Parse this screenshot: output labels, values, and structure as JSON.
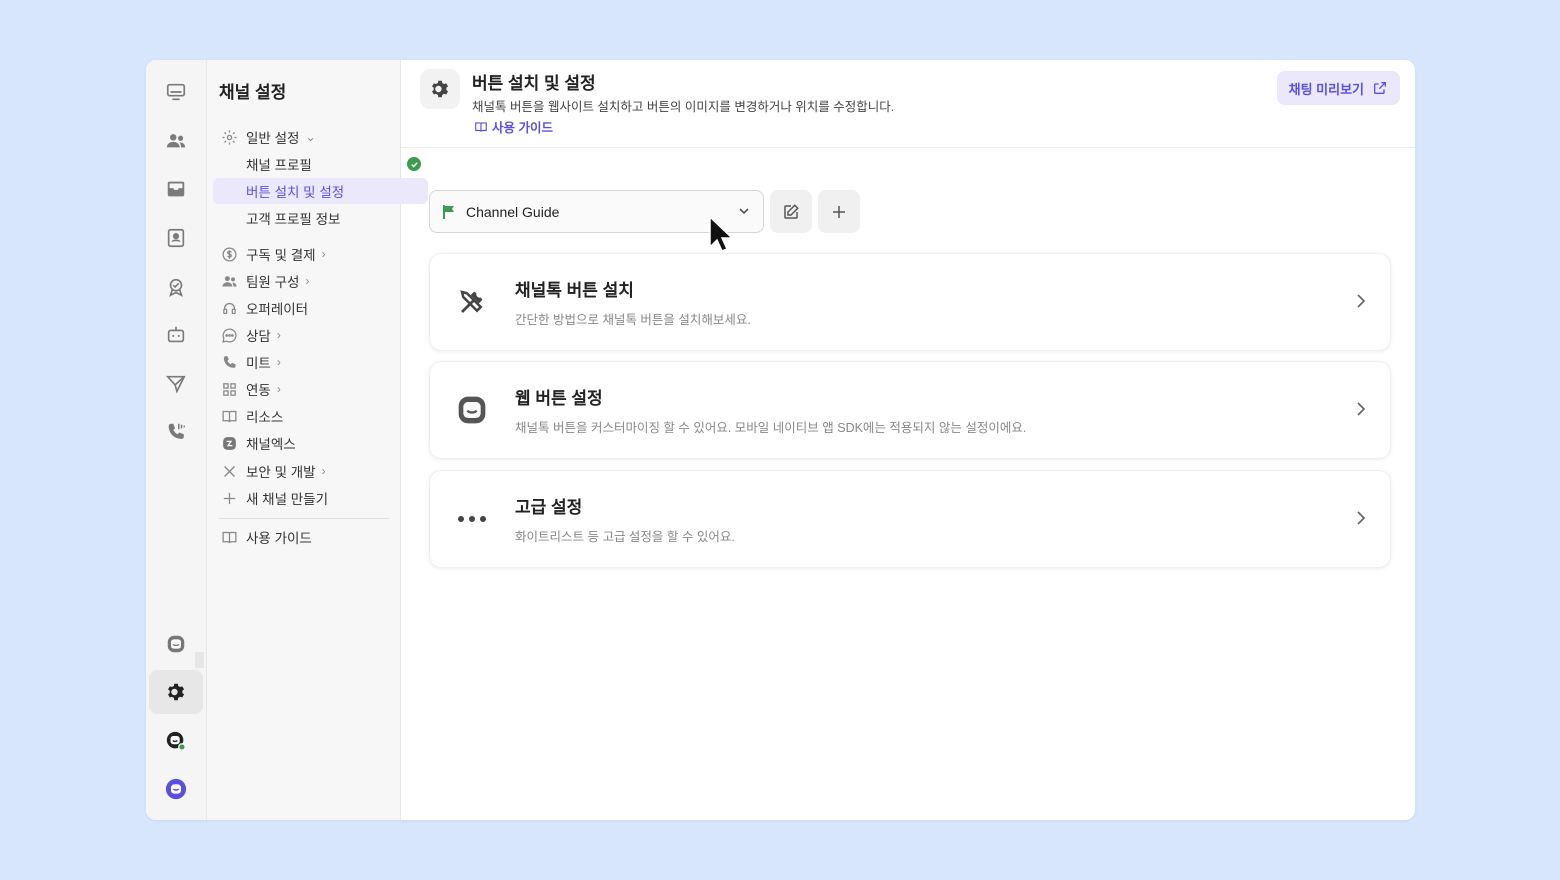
{
  "sidebar": {
    "title": "채널 설정",
    "items": [
      {
        "label": "일반 설정",
        "icon": "gear-icon",
        "chevron": "down"
      },
      {
        "label": "채널 프로필",
        "sub": true,
        "status": "check-circle-icon"
      },
      {
        "label": "버튼 설치 및 설정",
        "sub": true,
        "selected": true
      },
      {
        "label": "고객 프로필 정보",
        "sub": true
      },
      {
        "label": "구독 및 결제",
        "icon": "dollar-icon",
        "chevron": "right"
      },
      {
        "label": "팀원 구성",
        "icon": "team-icon",
        "chevron": "right"
      },
      {
        "label": "오퍼레이터",
        "icon": "headset-icon"
      },
      {
        "label": "상담",
        "icon": "chat-bubble-icon",
        "chevron": "right"
      },
      {
        "label": "미트",
        "icon": "phone-icon",
        "chevron": "right"
      },
      {
        "label": "연동",
        "icon": "grid-icon",
        "chevron": "right"
      },
      {
        "label": "리소스",
        "icon": "book-icon"
      },
      {
        "label": "채널엑스",
        "icon": "channel-x-icon"
      },
      {
        "label": "보안 및 개발",
        "icon": "tools-icon",
        "chevron": "right"
      },
      {
        "label": "새 채널 만들기",
        "icon": "plus-icon"
      },
      {
        "label": "사용 가이드",
        "icon": "book-icon"
      }
    ]
  },
  "header": {
    "title": "버튼 설치 및 설정",
    "description": "채널톡 버튼을 웹사이트 설치하고 버튼의 이미지를 변경하거나 위치를 수정합니다.",
    "guide_link": "사용 가이드",
    "preview_button": "채팅 미리보기"
  },
  "selector": {
    "value": "Channel Guide",
    "flag_color": "#3a9c4c"
  },
  "cards": [
    {
      "title": "채널톡 버튼 설치",
      "description": "간단한 방법으로 채널톡 버튼을 설치해보세요.",
      "icon": "tools-icon"
    },
    {
      "title": "웹 버튼 설정",
      "description": "채널톡 버튼을 커스터마이징 할 수 있어요. 모바일 네이티브 앱 SDK에는 적용되지 않는 설정이에요.",
      "icon": "channel-chat-icon"
    },
    {
      "title": "고급 설정",
      "description": "화이트리스트 등 고급 설정을 할 수 있어요.",
      "icon": "more-dots-icon"
    }
  ],
  "colors": {
    "accent": "#5b4fe0",
    "background": "#d7e5fd",
    "success": "#3a9c4c"
  }
}
